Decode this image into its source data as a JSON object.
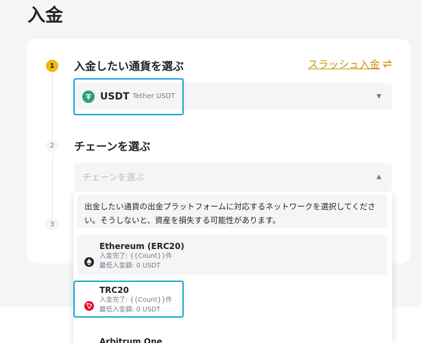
{
  "page": {
    "title": "入金"
  },
  "steps": [
    {
      "number": "1",
      "title": "入金したい通貨を選ぶ"
    },
    {
      "number": "2",
      "title": "チェーンを選ぶ"
    },
    {
      "number": "3"
    }
  ],
  "slash_link": {
    "label": "スラッシュ入金",
    "icon": "swap-arrows-icon"
  },
  "coin_select": {
    "symbol": "USDT",
    "name": "Tether USDT",
    "icon": "tether-icon"
  },
  "chain_select": {
    "placeholder": "チェーンを選ぶ"
  },
  "dropdown": {
    "warning": "出金したい通貨の出金プラットフォームに対応するネットワークを選択してください。そうしないと、資産を損失する可能性があります。",
    "networks": [
      {
        "name": "Ethereum (ERC20)",
        "arrival": "入金完了: {{Count}}件",
        "minimum": "最低入金額: 0 USDT",
        "icon": "ethereum-icon"
      },
      {
        "name": "TRC20",
        "arrival": "入金完了: {{Count}}件",
        "minimum": "最低入金額: 0 USDT",
        "icon": "tron-icon"
      },
      {
        "name": "Arbitrum One",
        "icon": "arbitrum-icon"
      }
    ]
  },
  "colors": {
    "accent": "#f0b90b",
    "link": "#c99400",
    "highlight": "#1aa7d6",
    "tether": "#26a17b",
    "tron": "#eb0029"
  }
}
